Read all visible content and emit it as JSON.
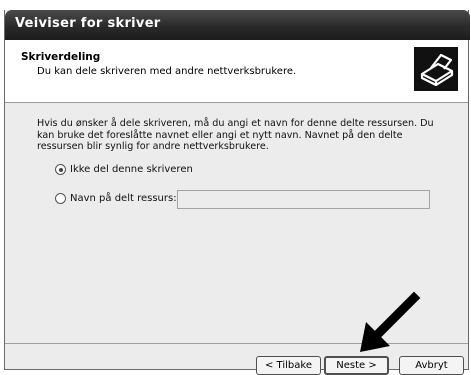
{
  "window": {
    "title": "Veiviser for skriver"
  },
  "header": {
    "title": "Skriverdeling",
    "subtitle": "Du kan dele skriveren med andre nettverksbrukere.",
    "icon": "printer-icon"
  },
  "body": {
    "description": "Hvis du ønsker å dele skriveren, må du angi et navn for denne delte ressursen. Du kan bruke det foreslåtte navnet eller angi et nytt navn. Navnet på den delte ressursen blir synlig for andre nettverksbrukere."
  },
  "options": {
    "no_share_label": "Ikke del denne skriveren",
    "no_share_selected": true,
    "share_name_label": "Navn på delt ressurs:",
    "share_name_selected": false,
    "share_name_value": ""
  },
  "buttons": {
    "back_label": "< Tilbake",
    "next_label": "Neste >",
    "cancel_label": "Avbryt"
  }
}
